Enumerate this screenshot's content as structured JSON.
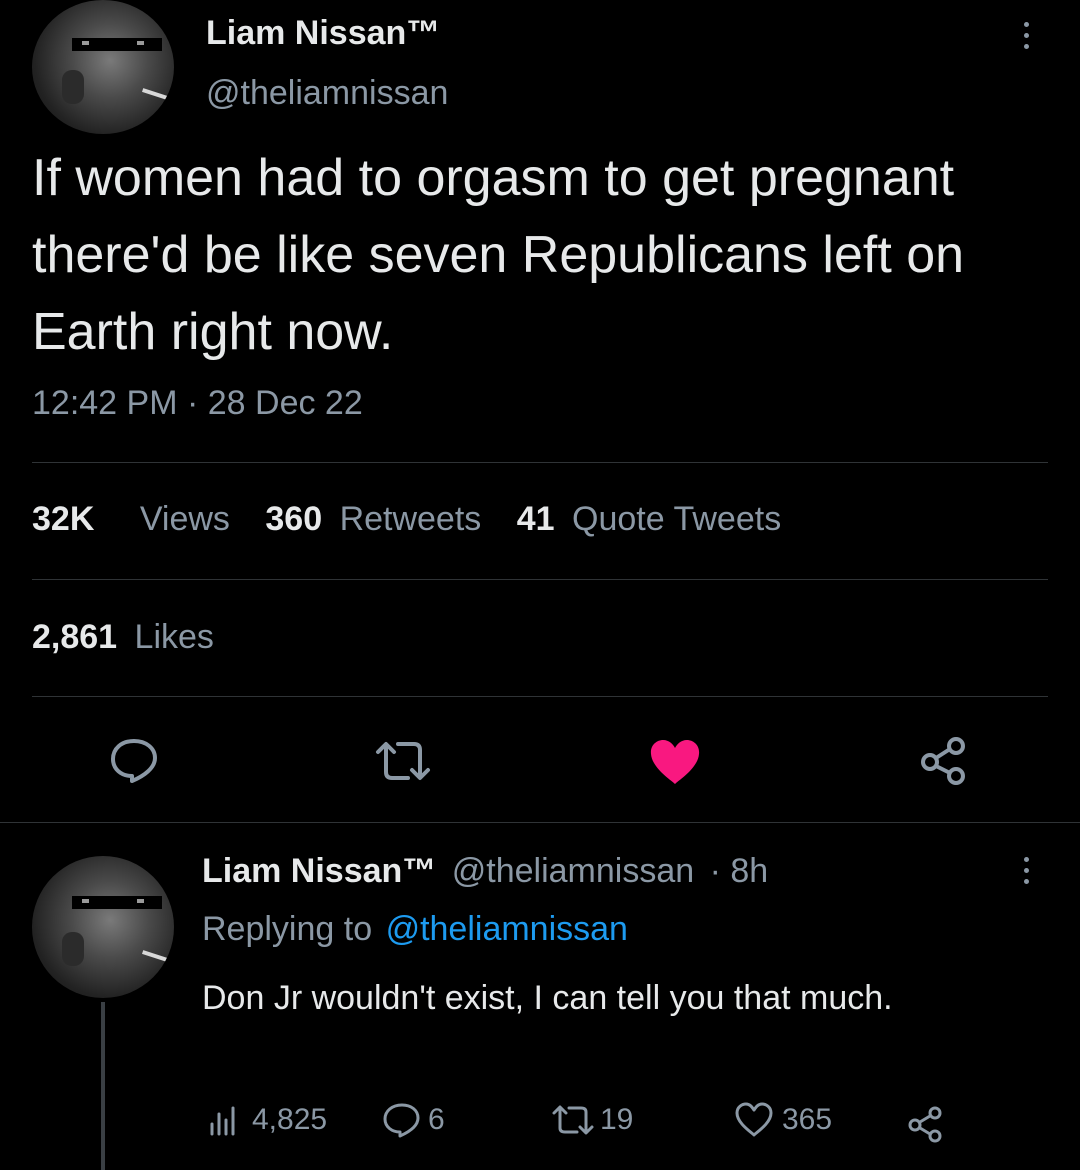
{
  "main_tweet": {
    "display_name": "Liam Nissan™",
    "handle": "@theliamnissan",
    "text": "If women had to orgasm to get pregnant there'd be like seven Republicans left on Earth right now.",
    "timestamp": "12:42 PM · 28 Dec 22",
    "stats": {
      "views_count": "32K",
      "views_label": "Views",
      "retweets_count": "360",
      "retweets_label": "Retweets",
      "quotes_count": "41",
      "quotes_label": "Quote Tweets",
      "likes_count": "2,861",
      "likes_label": "Likes"
    },
    "actions": {
      "reply": "reply-icon",
      "retweet": "retweet-icon",
      "like": "heart-filled-icon",
      "share": "share-icon"
    },
    "like_color": "#f91880"
  },
  "reply": {
    "display_name": "Liam Nissan™",
    "handle": "@theliamnissan",
    "time": "· 8h",
    "replying_to_prefix": "Replying to",
    "replying_to_handle": "@theliamnissan",
    "text": "Don Jr wouldn't exist, I can tell you that much.",
    "metrics": {
      "views": "4,825",
      "replies": "6",
      "retweets": "19",
      "likes": "365"
    }
  },
  "colors": {
    "background": "#000000",
    "text": "#e7e9ea",
    "muted": "#8b98a5",
    "link": "#1d9bf0",
    "divider": "#2f3336"
  }
}
